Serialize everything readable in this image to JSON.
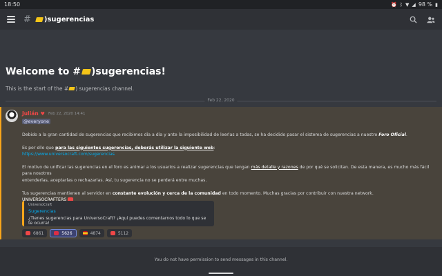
{
  "status_bar": {
    "time": "18:50",
    "battery": "98 %",
    "icons": [
      "alarm-icon",
      "bluetooth-icon",
      "wifi-icon",
      "signal-icon",
      "battery-icon"
    ]
  },
  "header": {
    "hash": "#",
    "channel_name": ")sugerencias",
    "icons": [
      "hamburger-icon",
      "search-icon",
      "members-icon"
    ]
  },
  "welcome": {
    "title_prefix": "Welcome to #",
    "title_suffix": ")sugerencias!",
    "subtitle_prefix": "This is the start of the #",
    "subtitle_suffix": ") sugerencias channel."
  },
  "date_divider": "Feb 22, 2020",
  "message": {
    "author": "Julián",
    "timestamp": "Feb 22, 2020 14:41",
    "mention": "@everyone",
    "p1a": "Debido a la gran cantidad de sugerencias que recibimos día a día y ante la imposibilidad de leerlas a todas, se ha decidido pasar el sistema de sugerencias a nuestro ",
    "p1b": "Foro Oficial",
    "p1c": ".",
    "p2a": "Es por ello que ",
    "p2b": "para las siguientes sugerencias, deberás utilizar la siguiente web",
    "p2c": ":",
    "link": "https://www.universocraft.com/sugerencias",
    "p3a": "El motivo de unificar las sugerencias en el foro es animar a los usuarios a realizar sugerencias que tengan ",
    "p3b": "más detalle y razones",
    "p3c": " de por qué se solicitan. De esta manera, es mucho más fácil para nosotros",
    "p3d": "entenderlas, aceptarlas o rechazarlas. Así, tu sugerencia no se perderá entre muchas.",
    "p4a": "Tus sugerencias mantienen al servidor en ",
    "p4b": "constante evolución y cerca de la comunidad",
    "p4c": " en todo momento. Muchas gracias por contribuir con nuestra network.",
    "signature": "UNIVERSOCRAFTERS",
    "embed": {
      "provider": "UniversoCraft",
      "title": "Sugerencias",
      "description": "¿Tienes sugerencias para UniversoCraft? ¡Aquí puedes comentarnos todo lo que se te ocurra!"
    },
    "reactions": [
      {
        "emoji": "heart-icon",
        "color": "#f04747",
        "count": "6861",
        "active": false
      },
      {
        "emoji": "heart-icon",
        "color": "#dd2e44",
        "count": "5626",
        "active": true
      },
      {
        "emoji": "flag-spain-icon",
        "color": "#f5c518",
        "count": "4874",
        "active": false
      },
      {
        "emoji": "heart-letter-icon",
        "color": "#f04747",
        "count": "5112",
        "active": false
      }
    ]
  },
  "footer": {
    "no_permission": "You do not have permission to send messages in this channel."
  },
  "colors": {
    "background": "#36393f",
    "header": "#2f3136",
    "highlight": "#49443c",
    "mention_border": "#faa61a",
    "link": "#00b0f4",
    "author": "#f04747"
  }
}
